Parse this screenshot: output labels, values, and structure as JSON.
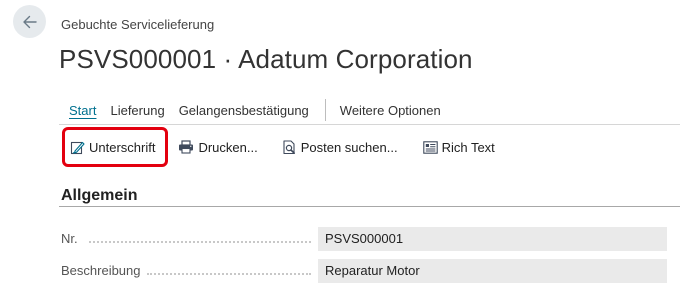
{
  "header": {
    "caption": "Gebuchte Servicelieferung",
    "title": "PSVS000001 · Adatum Corporation"
  },
  "tabs": [
    {
      "label": "Start",
      "active": true
    },
    {
      "label": "Lieferung"
    },
    {
      "label": "Gelangensbestätigung"
    },
    {
      "label": "Weitere Optionen"
    }
  ],
  "actions": [
    {
      "label": "Unterschrift",
      "icon": "signature-icon"
    },
    {
      "label": "Drucken...",
      "icon": "printer-icon"
    },
    {
      "label": "Posten suchen...",
      "icon": "find-entries-icon"
    },
    {
      "label": "Rich Text",
      "icon": "rich-text-icon"
    }
  ],
  "section": {
    "title": "Allgemein"
  },
  "fields": [
    {
      "label": "Nr.",
      "value": "PSVS000001"
    },
    {
      "label": "Beschreibung",
      "value": "Reparatur Motor"
    }
  ],
  "colors": {
    "accent": "#00708f",
    "highlight": "#e3000f",
    "field_bg": "#eaeaea"
  }
}
